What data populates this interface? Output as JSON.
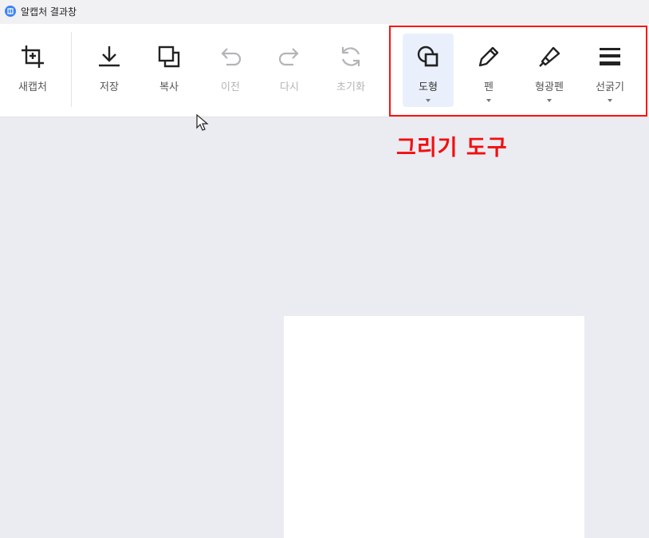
{
  "window": {
    "title": "알캡처 결과창"
  },
  "toolbar": {
    "tools": [
      {
        "label": "새캡처",
        "icon": "crop-icon",
        "enabled": true
      },
      {
        "label": "저장",
        "icon": "download-icon",
        "enabled": true
      },
      {
        "label": "복사",
        "icon": "copy-icon",
        "enabled": true
      },
      {
        "label": "이전",
        "icon": "undo-icon",
        "enabled": false
      },
      {
        "label": "다시",
        "icon": "redo-icon",
        "enabled": false
      },
      {
        "label": "초기화",
        "icon": "reset-icon",
        "enabled": false
      },
      {
        "label": "도형",
        "icon": "shape-icon",
        "enabled": true,
        "selected": true,
        "has_dropdown": true
      },
      {
        "label": "펜",
        "icon": "pen-icon",
        "enabled": true,
        "has_dropdown": true
      },
      {
        "label": "형광펜",
        "icon": "highlighter-icon",
        "enabled": true,
        "has_dropdown": true
      },
      {
        "label": "선굵기",
        "icon": "line-weight-icon",
        "enabled": true,
        "has_dropdown": true
      }
    ]
  },
  "annotation": {
    "text": "그리기 도구",
    "color": "#f20f0f"
  },
  "colors": {
    "accent": "#3b82f6",
    "highlight": "#ff1010",
    "canvas_bg": "#ebebf2"
  }
}
